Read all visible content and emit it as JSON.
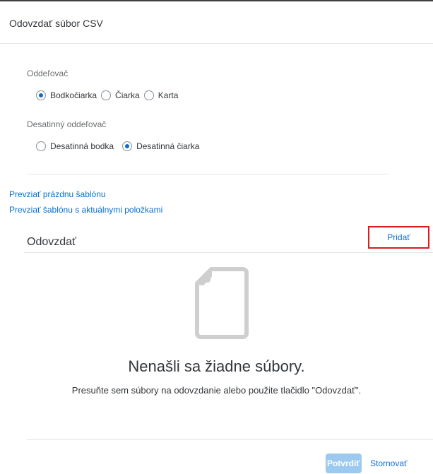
{
  "dialog": {
    "title": "Odovzdať súbor CSV"
  },
  "separator": {
    "label": "Oddeľovač",
    "options": [
      {
        "label": "Bodkočiarka",
        "selected": true
      },
      {
        "label": "Čiarka",
        "selected": false
      },
      {
        "label": "Karta",
        "selected": false
      }
    ]
  },
  "decimal_separator": {
    "label": "Desatinný oddeľovač",
    "options": [
      {
        "label": "Desatinná bodka",
        "selected": false
      },
      {
        "label": "Desatinná čiarka",
        "selected": true
      }
    ]
  },
  "links": {
    "empty_template": "Prevziať prázdnu šablónu",
    "current_template": "Prevziať šablónu s aktuálnymi položkami"
  },
  "upload": {
    "title": "Odovzdať",
    "add_label": "Pridať",
    "empty_title": "Nenašli sa žiadne súbory.",
    "empty_description": "Presuňte sem súbory na odovzdanie alebo použite tlačidlo \"Odovzdať\"."
  },
  "footer": {
    "confirm_label": "Potvrdiť",
    "cancel_label": "Stornovať"
  },
  "colors": {
    "accent": "#0a6ed1",
    "highlight_border": "#e0191c",
    "confirm_disabled": "#9cc9ef"
  },
  "icons": {
    "empty_state": "document-icon"
  }
}
